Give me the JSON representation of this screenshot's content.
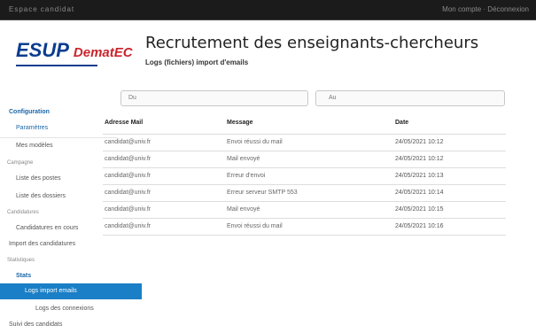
{
  "topbar": {
    "left": "Espace candidat",
    "right": "Mon compte · Déconnexion"
  },
  "logo": {
    "esup": "ESUP",
    "demat": "DematEC"
  },
  "header": {
    "title": "Recrutement des enseignants-chercheurs",
    "subtitle": "Logs (fichiers) import d'emails"
  },
  "filters": [
    {
      "label": "Du"
    },
    {
      "label": "Au"
    }
  ],
  "sidebar": {
    "items": [
      {
        "label": "Configuration",
        "kind": "head"
      },
      {
        "label": "Paramètres",
        "kind": "link"
      },
      {
        "label": "Mes modèles",
        "kind": "item"
      },
      {
        "label": "Campagne",
        "kind": "sec"
      },
      {
        "label": "Liste des postes",
        "kind": "item"
      },
      {
        "label": "Liste des dossiers",
        "kind": "item"
      },
      {
        "label": "Candidatures",
        "kind": "sec"
      },
      {
        "label": "Candidatures en cours",
        "kind": "item"
      },
      {
        "label": "Import des candidatures",
        "kind": "item"
      },
      {
        "label": "Statistiques",
        "kind": "sec"
      },
      {
        "label": "Stats",
        "kind": "head"
      },
      {
        "label": "Logs import emails",
        "kind": "active"
      },
      {
        "label": "Logs des connexions",
        "kind": "item"
      },
      {
        "label": "Suivi des candidats",
        "kind": "item"
      }
    ]
  },
  "table": {
    "headers": [
      "Adresse Mail",
      "Message",
      "Date"
    ],
    "rows": [
      {
        "email": "candidat@univ.fr",
        "message": "Envoi réussi du mail",
        "date": "24/05/2021 10:12"
      },
      {
        "email": "candidat@univ.fr",
        "message": "Mail envoyé",
        "date": "24/05/2021 10:12"
      },
      {
        "email": "candidat@univ.fr",
        "message": "Erreur d'envoi",
        "date": "24/05/2021 10:13"
      },
      {
        "email": "candidat@univ.fr",
        "message": "Erreur serveur SMTP 553",
        "date": "24/05/2021 10:14"
      },
      {
        "email": "candidat@univ.fr",
        "message": "Mail envoyé",
        "date": "24/05/2021 10:15"
      },
      {
        "email": "candidat@univ.fr",
        "message": "Envoi réussi du mail",
        "date": "24/05/2021 10:16"
      }
    ]
  },
  "colors": {
    "topbar": "#1b1b1b",
    "brand_blue": "#0a3d8f",
    "brand_red": "#c8252c",
    "active": "#1a7fc6"
  }
}
